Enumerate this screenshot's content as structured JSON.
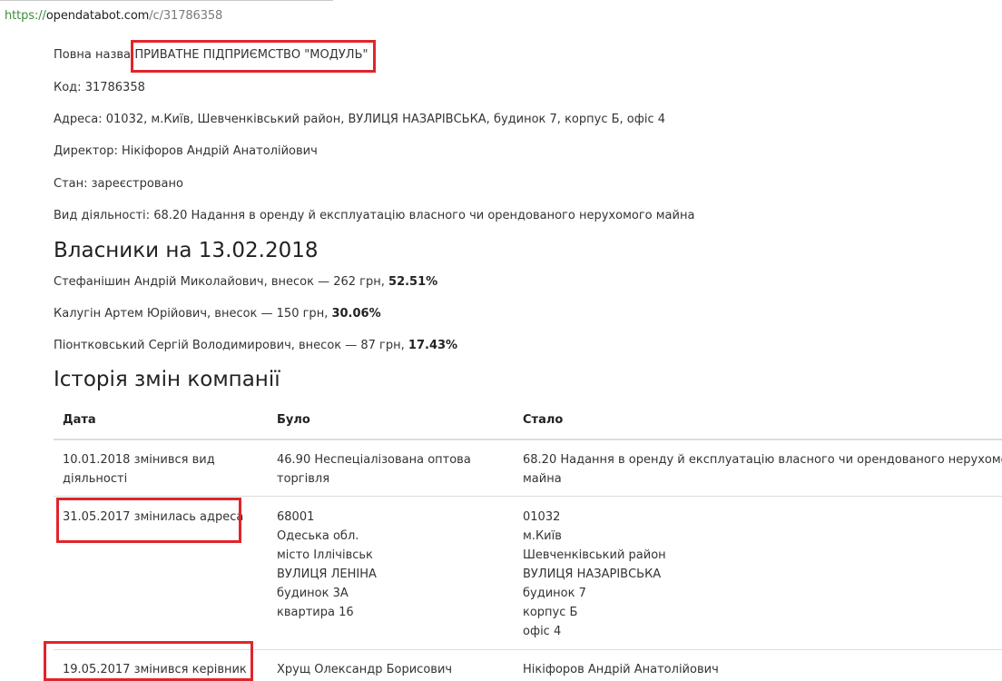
{
  "browser": {
    "url_scheme": "https://",
    "url_host": "opendatabot.com",
    "url_path": "/c/31786358"
  },
  "company": {
    "full_name_label": "Повна назва:",
    "full_name": "ПРИВАТНЕ ПІДПРИЄМСТВО \"МОДУЛЬ\"",
    "code_label": "Код:",
    "code": "31786358",
    "address_label": "Адреса:",
    "address": "01032, м.Київ, Шевченківський район, ВУЛИЦЯ НАЗАРІВСЬКА, будинок 7, корпус Б, офіс 4",
    "director_label": "Директор:",
    "director": "Нікіфоров Андрій Анатолійович",
    "status_label": "Стан:",
    "status": "зареєстровано",
    "activity_label": "Вид діяльності:",
    "activity": "68.20 Надання в оренду й експлуатацію власного чи орендованого нерухомого майна"
  },
  "owners": {
    "heading": "Власники на 13.02.2018",
    "items": [
      {
        "text": "Стефанішин Андрій Миколайович, внесок — 262 грн,",
        "share": "52.51%"
      },
      {
        "text": "Калугін Артем Юрійович, внесок — 150 грн,",
        "share": "30.06%"
      },
      {
        "text": "Піонтковський Сергій Володимирович, внесок — 87 грн,",
        "share": "17.43%"
      }
    ]
  },
  "history": {
    "heading": "Історія змін компанії",
    "columns": [
      "Дата",
      "Було",
      "Стало"
    ],
    "rows": [
      {
        "date": [
          "10.01.2018 змінився вид",
          "діяльності"
        ],
        "was": [
          "46.90 Неспеціалізована оптова",
          "торгівля"
        ],
        "now": [
          "68.20 Надання в оренду й експлуатацію власного чи орендованого нерухомого",
          "майна"
        ]
      },
      {
        "date": [
          "31.05.2017 змінилась адреса"
        ],
        "was": [
          "68001",
          "Одеська обл.",
          "місто Іллічівськ",
          "ВУЛИЦЯ ЛЕНІНА",
          "будинок 3А",
          "квартира 16"
        ],
        "now": [
          "01032",
          "м.Київ",
          "Шевченківський район",
          "ВУЛИЦЯ НАЗАРІВСЬКА",
          "будинок 7",
          "корпус Б",
          "офіс 4"
        ]
      },
      {
        "date": [
          "19.05.2017 змінився керівник"
        ],
        "was": [
          "Хрущ Олександр Борисович"
        ],
        "now": [
          "Нікіфоров Андрій Анатолійович"
        ]
      }
    ]
  },
  "annotation_color": "#e0252b"
}
